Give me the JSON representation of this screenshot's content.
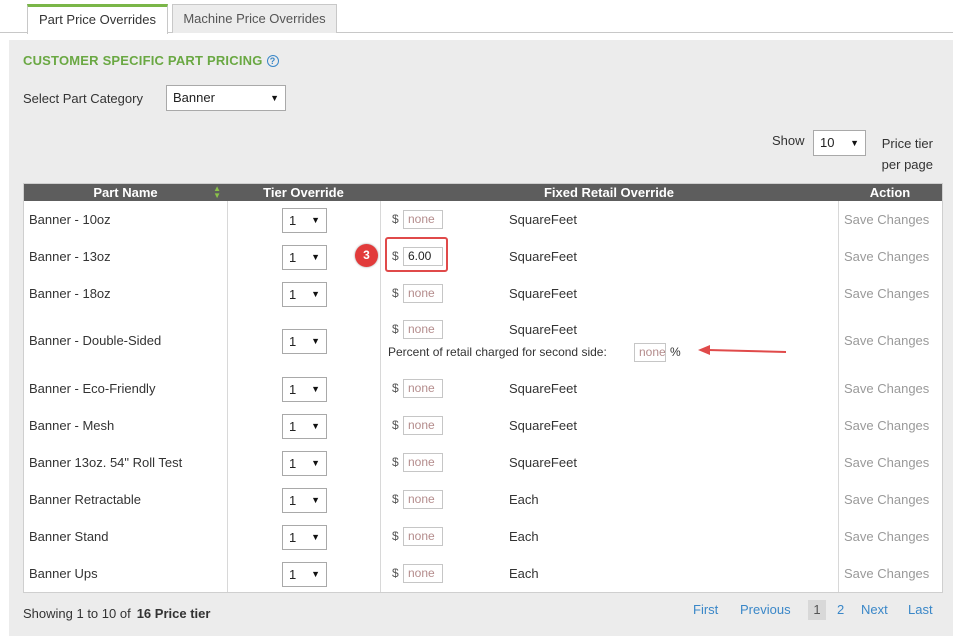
{
  "tabs": [
    {
      "label": "Part Price Overrides",
      "active": true
    },
    {
      "label": "Machine Price Overrides",
      "active": false
    }
  ],
  "section_title": "CUSTOMER SPECIFIC PART PRICING",
  "help_glyph": "?",
  "category": {
    "label": "Select Part Category",
    "selected": "Banner"
  },
  "page_size": {
    "show_label": "Show",
    "selected": "10",
    "per_label_1": "Price tier",
    "per_label_2": "per page"
  },
  "columns": [
    "Part Name",
    "Tier Override",
    "Fixed Retail Override",
    "Action"
  ],
  "rows": [
    {
      "name": "Banner - 10oz",
      "tier": "1",
      "currency": "$",
      "value": "none",
      "unit": "SquareFeet",
      "action": "Save Changes"
    },
    {
      "name": "Banner - 13oz",
      "tier": "1",
      "currency": "$",
      "value": "6.00",
      "unit": "SquareFeet",
      "action": "Save Changes"
    },
    {
      "name": "Banner - 18oz",
      "tier": "1",
      "currency": "$",
      "value": "none",
      "unit": "SquareFeet",
      "action": "Save Changes"
    },
    {
      "name": "Banner - Double-Sided",
      "tier": "1",
      "currency": "$",
      "value": "none",
      "unit": "SquareFeet",
      "action": "Save Changes",
      "second_side_label": "Percent of retail charged for second side:",
      "second_side_value": "none",
      "second_side_suffix": "%"
    },
    {
      "name": "Banner - Eco-Friendly",
      "tier": "1",
      "currency": "$",
      "value": "none",
      "unit": "SquareFeet",
      "action": "Save Changes"
    },
    {
      "name": "Banner - Mesh",
      "tier": "1",
      "currency": "$",
      "value": "none",
      "unit": "SquareFeet",
      "action": "Save Changes"
    },
    {
      "name": "Banner 13oz. 54\" Roll Test",
      "tier": "1",
      "currency": "$",
      "value": "none",
      "unit": "SquareFeet",
      "action": "Save Changes"
    },
    {
      "name": "Banner Retractable",
      "tier": "1",
      "currency": "$",
      "value": "none",
      "unit": "Each",
      "action": "Save Changes"
    },
    {
      "name": "Banner Stand",
      "tier": "1",
      "currency": "$",
      "value": "none",
      "unit": "Each",
      "action": "Save Changes"
    },
    {
      "name": "Banner Ups",
      "tier": "1",
      "currency": "$",
      "value": "none",
      "unit": "Each",
      "action": "Save Changes"
    }
  ],
  "annotation": {
    "badge": "3",
    "color": "#e23b3b"
  },
  "footer": {
    "showing": "Showing 1 to 10 of",
    "total": "16 Price tier"
  },
  "pagination": {
    "first": "First",
    "previous": "Previous",
    "current": "1",
    "next_page": "2",
    "next": "Next",
    "last": "Last"
  },
  "colors": {
    "accent_green": "#6aa843",
    "header_gray": "#5d5d5d",
    "link_blue": "#3a87c8",
    "annotation_red": "#e04a4a"
  }
}
